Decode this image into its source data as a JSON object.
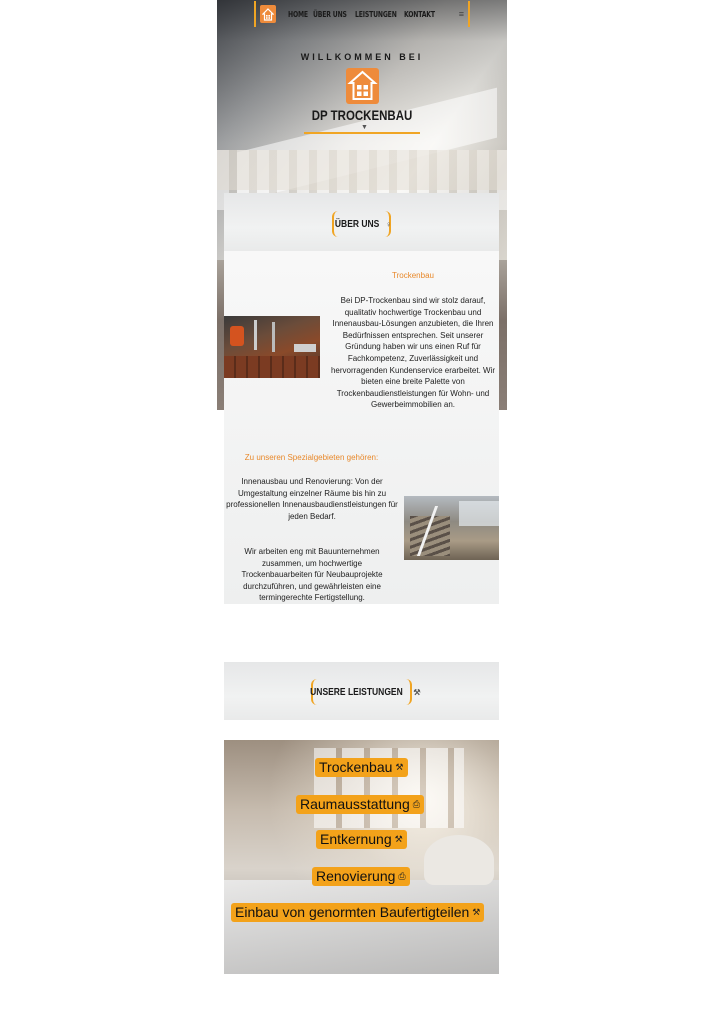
{
  "nav": {
    "items": [
      "Home",
      "Über uns",
      "Leistungen",
      "Kontakt"
    ],
    "menu_icon": "hamburger-icon"
  },
  "hero": {
    "welcome": "WILLKOMMEN BEI",
    "brand": "DP TROCKENBAU"
  },
  "about": {
    "section_title": "ÜBER UNS",
    "section_icon": "lightbulb-icon",
    "subtitle": "Trockenbau",
    "text": "Bei DP-Trockenbau sind wir stolz darauf, qualitativ hochwertige Trockenbau und Innenausbau-Lösungen anzubieten, die Ihren Bedürfnissen entsprechen. Seit unserer Gründung haben wir uns einen Ruf für Fachkompetenz, Zuverlässigkeit und hervorragenden Kundenservice erarbeitet. Wir bieten eine breite Palette von Trockenbaudienstleistungen für Wohn- und Gewerbeimmobilien an.",
    "specialties_title": "Zu unseren Spezialgebieten gehören:",
    "specialties_text1": "Innenausbau und Renovierung: Von der Umgestaltung einzelner Räume bis hin zu professionellen Innenausbaudienstleistungen für jeden Bedarf.",
    "specialties_text2": "Wir arbeiten eng mit Bauunternehmen zusammen, um hochwertige Trockenbauarbeiten für Neubauprojekte durchzuführen, und gewährleisten eine termingerechte Fertigstellung."
  },
  "services": {
    "section_title": "UNSERE LEISTUNGEN",
    "section_icon": "tools-icon",
    "items": [
      {
        "label": "Trockenbau",
        "icon": "hammer-icon"
      },
      {
        "label": "Raumausstattung",
        "icon": "paint-icon"
      },
      {
        "label": "Entkernung",
        "icon": "hammer-icon"
      },
      {
        "label": "Renovierung",
        "icon": "paint-icon"
      },
      {
        "label": "Einbau von genormten Baufertigteilen",
        "icon": "hammer-icon"
      }
    ]
  },
  "colors": {
    "accent": "#f0a524",
    "logo": "#ee8b3b",
    "button": "#f3a21a"
  }
}
